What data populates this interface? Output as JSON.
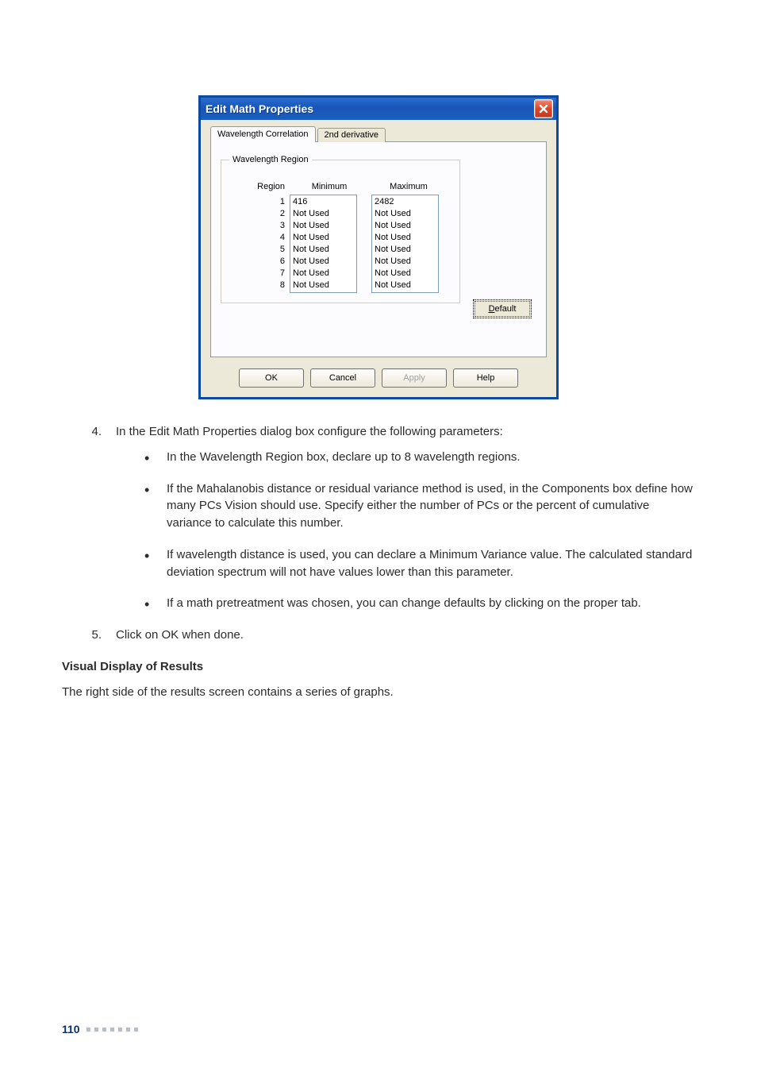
{
  "dialog": {
    "title": "Edit Math Properties",
    "tabs": {
      "active": "Wavelength Correlation",
      "inactive": "2nd derivative"
    },
    "fieldset_legend": "Wavelength Region",
    "headers": {
      "region": "Region",
      "min": "Minimum",
      "max": "Maximum"
    },
    "regions": [
      {
        "idx": "1",
        "min": "416",
        "max": "2482"
      },
      {
        "idx": "2",
        "min": "Not Used",
        "max": "Not Used"
      },
      {
        "idx": "3",
        "min": "Not Used",
        "max": "Not Used"
      },
      {
        "idx": "4",
        "min": "Not Used",
        "max": "Not Used"
      },
      {
        "idx": "5",
        "min": "Not Used",
        "max": "Not Used"
      },
      {
        "idx": "6",
        "min": "Not Used",
        "max": "Not Used"
      },
      {
        "idx": "7",
        "min": "Not Used",
        "max": "Not Used"
      },
      {
        "idx": "8",
        "min": "Not Used",
        "max": "Not Used"
      }
    ],
    "default_btn_pre": "D",
    "default_btn_post": "efault",
    "buttons": {
      "ok": "OK",
      "cancel": "Cancel",
      "apply": "Apply",
      "help": "Help"
    }
  },
  "doc": {
    "step4_num": "4.",
    "step4_text": "In the Edit Math Properties dialog box configure the following parameters:",
    "bullets": [
      "In the Wavelength Region box, declare up to 8 wavelength regions.",
      "If the Mahalanobis distance or residual variance method is used, in the Components box define how many PCs Vision should use. Specify either the number of PCs or the percent of cumulative variance to calculate this number.",
      "If wavelength distance is used, you can declare a Minimum Variance value. The calculated standard deviation spectrum will not have values lower than this parameter.",
      "If a math pretreatment was chosen, you can change defaults by clicking on the proper tab."
    ],
    "step5_num": "5.",
    "step5_text": "Click on OK when done.",
    "heading": "Visual Display of Results",
    "para": "The right side of the results screen contains a series of graphs."
  },
  "footer": {
    "page": "110"
  }
}
